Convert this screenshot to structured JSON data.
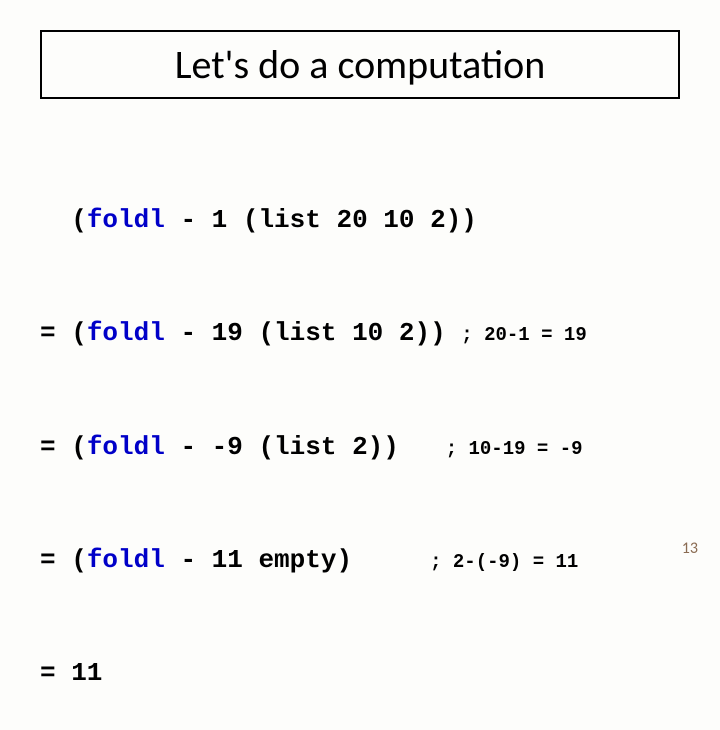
{
  "title": "Let's do a computation",
  "code": {
    "keyword": "foldl",
    "l0_eq": "  ",
    "l0_rest": " - 1 (list 20 10 2))",
    "l1_eq": "= ",
    "l1_rest": " - 19 (list 10 2)) ",
    "l1_comment": "; 20-1 = 19",
    "l2_eq": "= ",
    "l2_rest": " - -9 (list 2))   ",
    "l2_comment": "; 10-19 = -9",
    "l3_eq": "= ",
    "l3_rest": " - 11 empty)     ",
    "l3_comment": "; 2-(-9) = 11",
    "l4": "= 11"
  },
  "page_number": "13"
}
